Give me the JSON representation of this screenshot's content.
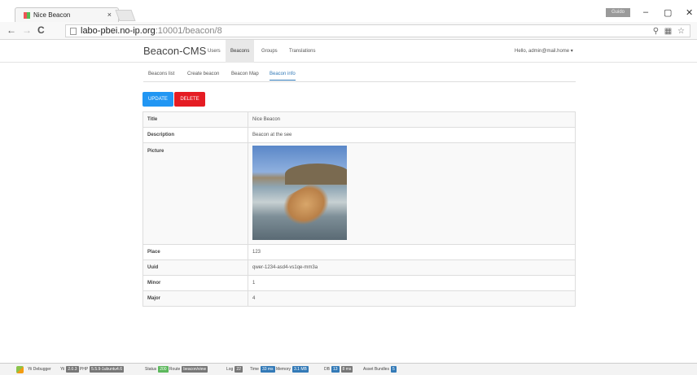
{
  "browser": {
    "tab_title": "Nice Beacon",
    "tab_close": "×",
    "user_badge": "Guido",
    "url_host": "labo-pbei.no-ip.org",
    "url_path": ":10001/beacon/8",
    "window_controls": [
      "–",
      "▢",
      "✕"
    ]
  },
  "app": {
    "brand": "Beacon-CMS",
    "nav": [
      "Users",
      "Beacons",
      "Groups",
      "Translations"
    ],
    "hello": "Hello, admin@mail.home ▾"
  },
  "subtabs": [
    "Beacons list",
    "Create beacon",
    "Beacon Map",
    "Beacon info"
  ],
  "buttons": {
    "update": "UPDATE",
    "delete": "DELETE"
  },
  "detail": [
    {
      "label": "Title",
      "value": "Nice Beacon"
    },
    {
      "label": "Description",
      "value": "Beacon at the see"
    },
    {
      "label": "Picture",
      "value": ""
    },
    {
      "label": "Place",
      "value": "123"
    },
    {
      "label": "Uuid",
      "value": "qwer-1234-asd4-vs1qe-mm3a"
    },
    {
      "label": "Minor",
      "value": "1"
    },
    {
      "label": "Major",
      "value": "4"
    }
  ],
  "debug": {
    "debugger": "Yii Debugger",
    "yii_label": "Yii",
    "yii_version": "2.0.3",
    "php_label": "PHP",
    "php_version": "5.5.9-1ubuntu4.6",
    "status_label": "Status",
    "status": "200",
    "route_label": "Route",
    "route": "beacon/view",
    "log_label": "Log",
    "log": "22",
    "time_label": "Time",
    "time": "33 ms",
    "memory_label": "Memory",
    "memory": "3.1 MB",
    "db_label": "DB",
    "db_count": "13",
    "db_time": "8 ms",
    "bundles_label": "Asset Bundles",
    "bundles": "5"
  },
  "colors": {
    "update": "#2196f3",
    "delete": "#e51c23",
    "link": "#337ab7"
  }
}
